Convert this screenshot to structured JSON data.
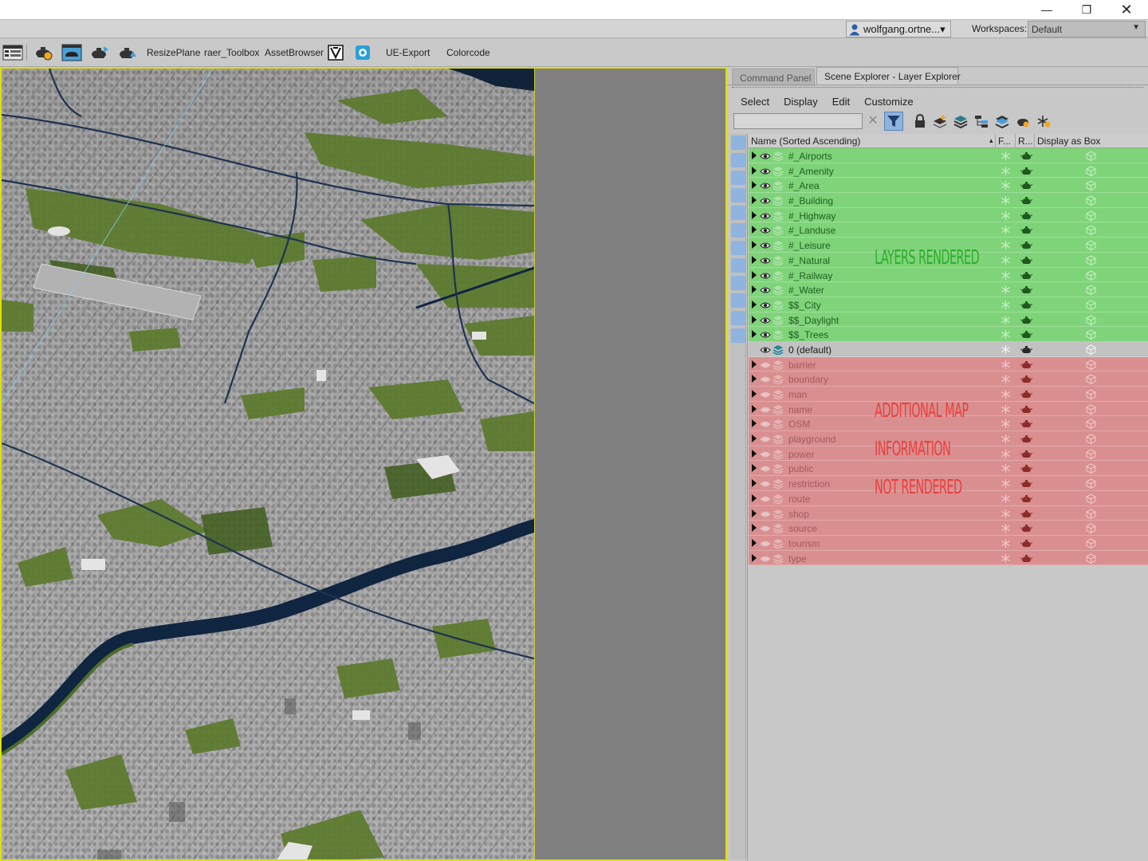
{
  "titlebar": {
    "minimize_icon": "minimize-icon",
    "maximize_icon": "restore-icon",
    "close_icon": "close-icon"
  },
  "account": {
    "user_label": "wolfgang.ortne...▾",
    "workspaces_label": "Workspaces:",
    "workspace_value": "Default"
  },
  "toolbar": {
    "items": [
      "ResizePlane",
      "raer_Toolbox",
      "AssetBrowser",
      "UE-Export",
      "Colorcode"
    ]
  },
  "panel": {
    "tabs": [
      "Command Panel",
      "Scene Explorer - Layer Explorer"
    ],
    "menu": [
      "Select",
      "Display",
      "Edit",
      "Customize"
    ],
    "search": {
      "value": "",
      "placeholder": ""
    },
    "headers": {
      "name": "Name (Sorted Ascending)",
      "sort_arrow": "▴",
      "freeze": "F...",
      "render": "R...",
      "display_box": "Display as Box"
    },
    "rendered_layers": [
      "#_Airports",
      "#_Amenity",
      "#_Area",
      "#_Building",
      "#_Highway",
      "#_Landuse",
      "#_Leisure",
      "#_Natural",
      "#_Railway",
      "#_Water",
      "$$_City",
      "$$_Daylight",
      "$$_Trees"
    ],
    "default_layer": "0 (default)",
    "hidden_layers": [
      "barrier",
      "boundary",
      "man",
      "name",
      "OSM",
      "playground",
      "power",
      "public",
      "restriction",
      "route",
      "shop",
      "source",
      "tourism",
      "type"
    ],
    "annotations": {
      "rendered": "LAYERS RENDERED",
      "not_rendered_1": "ADDITIONAL MAP",
      "not_rendered_2": "INFORMATION",
      "not_rendered_3": "NOT RENDERED"
    }
  },
  "colors": {
    "rendered_row": "#7fd47a",
    "hidden_row": "#d98f90",
    "default_row": "#c2c2c2",
    "viewport_border": "#e0e000",
    "annotation_green": "#2cae2c",
    "annotation_red": "#e9403d"
  }
}
